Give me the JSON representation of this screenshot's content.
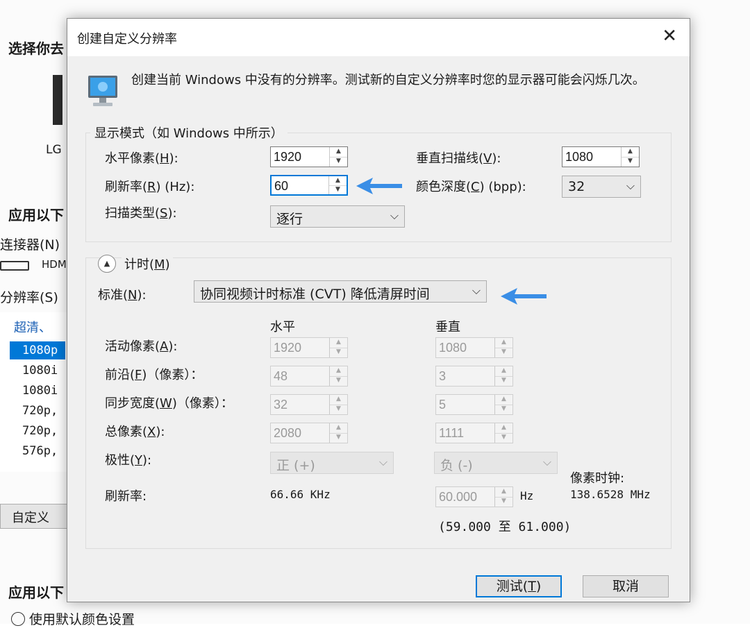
{
  "background": {
    "heading1": "选择你去",
    "monitor_label": "LG",
    "heading2": "应用以下",
    "connector_label": "连接器(N)",
    "connector_value": "HDM",
    "resolution_label": "分辨率(S)",
    "list_group": "超清、",
    "list_items": [
      "1080p",
      "1080i",
      "1080i",
      "720p,",
      "720p,",
      "576p,"
    ],
    "custom_button": "自定义",
    "heading3": "应用以下",
    "color_radio": "使用默认颜色设置"
  },
  "dialog": {
    "title": "创建自定义分辨率",
    "close_glyph": "✕",
    "info_text": "创建当前 Windows 中没有的分辨率。测试新的自定义分辨率时您的显示器可能会闪烁几次。",
    "display_mode": {
      "group_label": "显示模式（如 Windows 中所示）",
      "h_pixels_label": "水平像素",
      "h_pixels_key": "H",
      "h_pixels_value": "1920",
      "v_lines_label": "垂直扫描线",
      "v_lines_key": "V",
      "v_lines_value": "1080",
      "refresh_label": "刷新率",
      "refresh_key": "R",
      "refresh_unit": "(Hz):",
      "refresh_value": "60",
      "color_depth_label": "颜色深度",
      "color_depth_key": "C",
      "color_depth_unit": "(bpp):",
      "color_depth_value": "32",
      "scan_type_label": "扫描类型",
      "scan_type_key": "S",
      "scan_type_value": "逐行"
    },
    "timing": {
      "group_label": "计时",
      "group_key": "M",
      "standard_label": "标准",
      "standard_key": "N",
      "standard_value": "协同视频计时标准 (CVT) 降低清屏时间",
      "col_horizontal": "水平",
      "col_vertical": "垂直",
      "active_label": "活动像素",
      "active_key": "A",
      "active_h": "1920",
      "active_v": "1080",
      "front_label": "前沿",
      "front_key": "F",
      "front_unit": "（像素）：",
      "front_h": "48",
      "front_v": "3",
      "sync_label": "同步宽度",
      "sync_key": "W",
      "sync_unit": "（像素）：",
      "sync_h": "32",
      "sync_v": "5",
      "total_label": "总像素",
      "total_key": "X",
      "total_h": "2080",
      "total_v": "1111",
      "polarity_label": "极性",
      "polarity_key": "Y",
      "polarity_h": "正 (+)",
      "polarity_v": "负 (-)",
      "refresh_label": "刷新率:",
      "refresh_h": "66.66 KHz",
      "refresh_v": "60.000",
      "refresh_v_unit": "Hz",
      "refresh_range": "(59.000 至 61.000)",
      "pixel_clock_label": "像素时钟:",
      "pixel_clock_value": "138.6528 MHz"
    },
    "test_button": "测试",
    "test_key": "T",
    "cancel_button": "取消"
  },
  "colors": {
    "accent": "#0078d7",
    "annotation_arrow": "#3a8ee6"
  }
}
